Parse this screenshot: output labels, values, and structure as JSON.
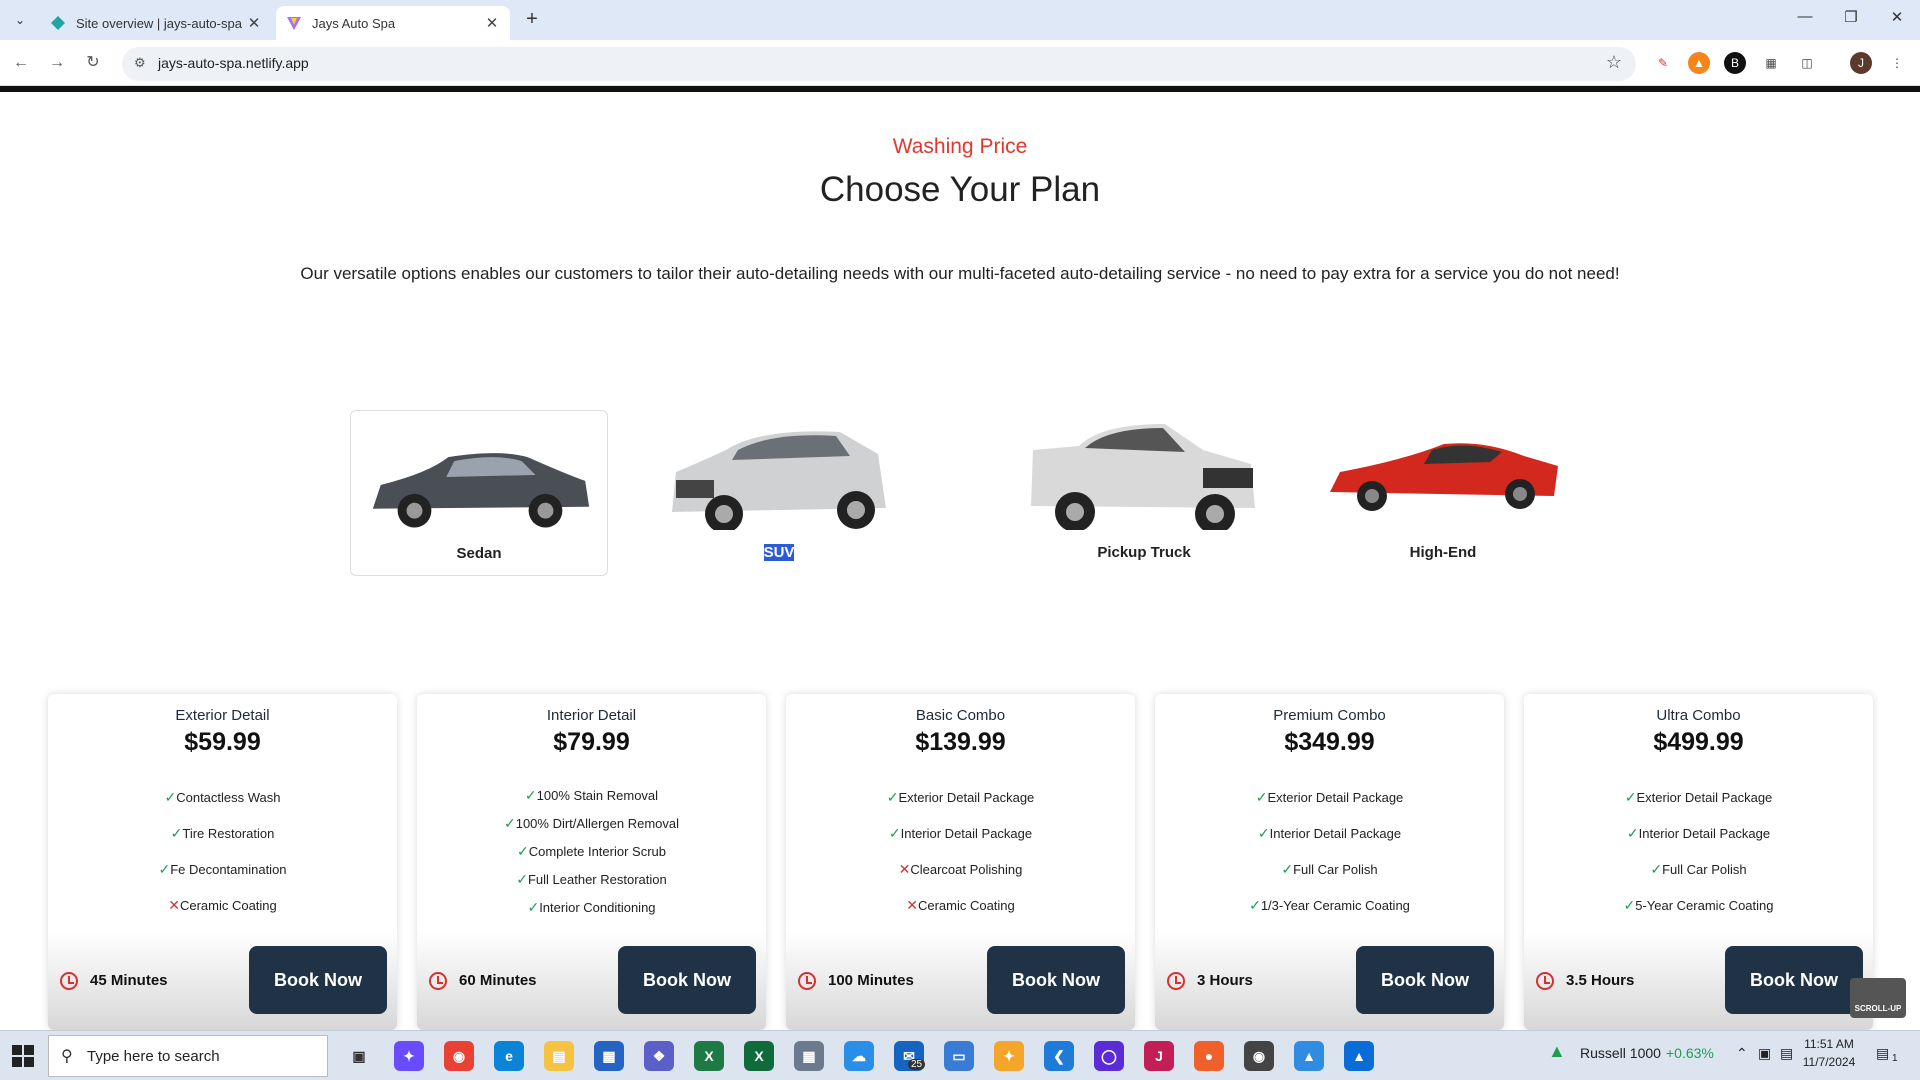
{
  "browser": {
    "tabs": [
      {
        "title": "Site overview | jays-auto-spa | N"
      },
      {
        "title": "Jays Auto Spa"
      }
    ],
    "url": "jays-auto-spa.netlify.app",
    "profile_initial": "J"
  },
  "section": {
    "eyebrow": "Washing Price",
    "title": "Choose Your Plan",
    "description": "Our versatile options enables our customers to tailor their auto-detailing needs with our multi-faceted auto-detailing service - no need to pay extra for a service you do not need!"
  },
  "vehicles": [
    {
      "label": "Sedan",
      "color": "#4a4e55"
    },
    {
      "label": "SUV",
      "color": "#cfd1d3"
    },
    {
      "label": "Pickup Truck",
      "color": "#d9d9d9"
    },
    {
      "label": "High-End",
      "color": "#d3281d"
    }
  ],
  "plans": [
    {
      "name": "Exterior Detail",
      "price": "$59.99",
      "duration": "45 Minutes",
      "features": [
        {
          "text": "Contactless Wash",
          "included": true
        },
        {
          "text": "Tire Restoration",
          "included": true
        },
        {
          "text": "Fe Decontamination",
          "included": true
        },
        {
          "text": "Ceramic Coating",
          "included": false
        }
      ]
    },
    {
      "name": "Interior Detail",
      "price": "$79.99",
      "duration": "60 Minutes",
      "features": [
        {
          "text": "100% Stain Removal",
          "included": true
        },
        {
          "text": "100% Dirt/Allergen Removal",
          "included": true
        },
        {
          "text": "Complete Interior Scrub",
          "included": true
        },
        {
          "text": "Full Leather Restoration",
          "included": true
        },
        {
          "text": "Interior Conditioning",
          "included": true
        }
      ]
    },
    {
      "name": "Basic Combo",
      "price": "$139.99",
      "duration": "100 Minutes",
      "features": [
        {
          "text": "Exterior Detail Package",
          "included": true
        },
        {
          "text": "Interior Detail Package",
          "included": true
        },
        {
          "text": "Clearcoat Polishing",
          "included": false
        },
        {
          "text": "Ceramic Coating",
          "included": false
        }
      ]
    },
    {
      "name": "Premium Combo",
      "price": "$349.99",
      "duration": "3 Hours",
      "features": [
        {
          "text": "Exterior Detail Package",
          "included": true
        },
        {
          "text": "Interior Detail Package",
          "included": true
        },
        {
          "text": "Full Car Polish",
          "included": true
        },
        {
          "text": "1/3-Year Ceramic Coating",
          "included": true
        }
      ]
    },
    {
      "name": "Ultra Combo",
      "price": "$499.99",
      "duration": "3.5 Hours",
      "features": [
        {
          "text": "Exterior Detail Package",
          "included": true
        },
        {
          "text": "Interior Detail Package",
          "included": true
        },
        {
          "text": "Full Car Polish",
          "included": true
        },
        {
          "text": "5-Year Ceramic Coating",
          "included": true
        }
      ]
    }
  ],
  "book_label": "Book Now",
  "scroll_up_label": "SCROLL-UP",
  "taskbar": {
    "search_placeholder": "Type here to search",
    "mail_badge": "25",
    "ticker": "Russell 1000",
    "ticker_change": "+0.63%",
    "time": "11:51 AM",
    "date": "11/7/2024",
    "notification_count": "1"
  }
}
